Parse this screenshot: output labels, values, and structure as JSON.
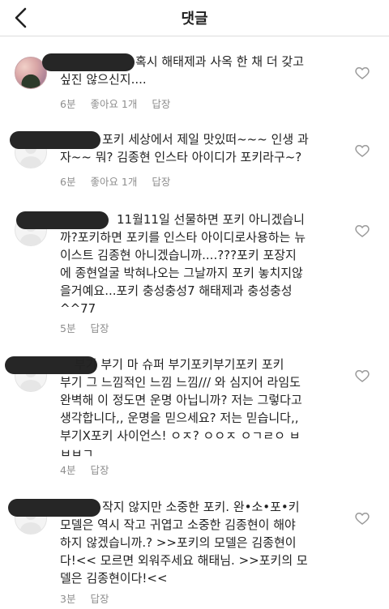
{
  "header": {
    "title": "댓글"
  },
  "comments": [
    {
      "text": "혹시 해태제과 사옥 한 채 더 갖고\n싶진 않으신지....",
      "time": "6분",
      "likes": "좋아요 1개",
      "reply": "답장"
    },
    {
      "text": "포키 세상에서 제일 맛있떠~~~ 인생 과\n자~~ 뭐? 김종현 인스타 아이디가 포키라구~?",
      "time": "6분",
      "likes": "좋아요 1개",
      "reply": "답장"
    },
    {
      "text": "11월11일 선물하면 포키 아니겠습니\n까?포키하면 포키를 인스타 아이디로사용하는 뉴\n이스트 김종현 아니겠습니까....???포키 포장지\n에 종현얼굴 박혀나오는 그날까지 포키 놓치지않\n을거예요...포키 충성충성7 해태제과 충성충성\n^^77",
      "time": "5분",
      "reply": "답장"
    },
    {
      "text": "부기 부기 마 슈퍼 부기포키부기포키 포키\n부기 그 느낌적인 느낌 느낌/// 와 심지어 라임도\n완벽해 이 정도면 운명 아닙니까? 저는 그렇다고\n생각합니다,, 운명을 믿으세요? 저는 믿습니다,,\n부기X포키 사이언스! ㅇㅈ? ㅇㅇㅈ ㅇㄱㄹㅇ ㅂ\nㅂㅂㄱ",
      "time": "4분",
      "reply": "답장"
    },
    {
      "text": "작지 않지만 소중한 포키. 완•소•포•키\n모델은 역시 작고 귀엽고 소중한 김종현이 해야\n하지 않겠습니까.? >>포키의 모델은 김종현이\n다!<< 모르면 외워주세요 해태님. >>포키의 모\n델은 김종현이다!<<",
      "time": "3분",
      "reply": "답장"
    }
  ]
}
